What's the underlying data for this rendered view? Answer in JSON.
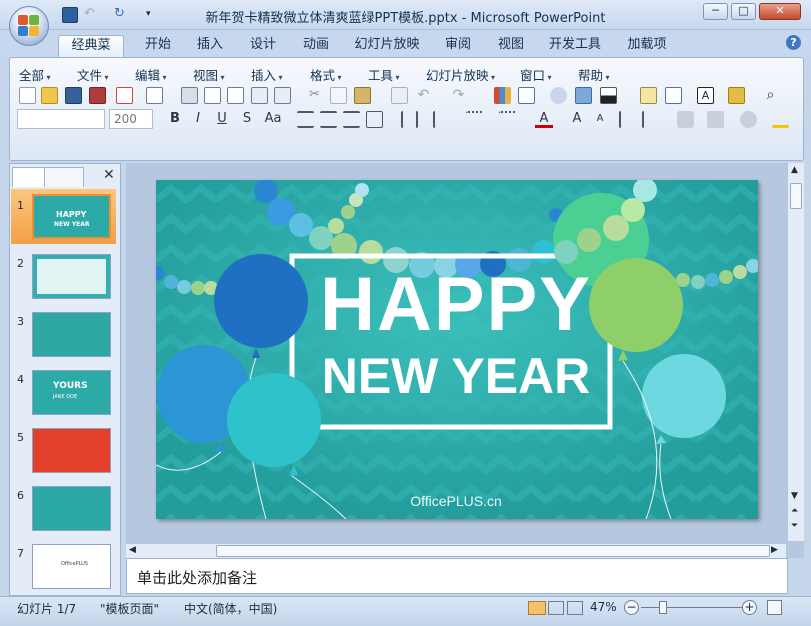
{
  "window": {
    "title": "新年贺卡精致微立体清爽蓝绿PPT模板.pptx - Microsoft PowerPoint",
    "minimize": "─",
    "maximize": "□",
    "close": "✕"
  },
  "tabs": [
    "经典菜单",
    "开始",
    "插入",
    "设计",
    "动画",
    "幻灯片放映",
    "审阅",
    "视图",
    "开发工具",
    "加载项"
  ],
  "help_glyph": "?",
  "menu": [
    "全部",
    "文件",
    "编辑",
    "视图",
    "插入",
    "格式",
    "工具",
    "幻灯片放映",
    "窗口",
    "帮助"
  ],
  "font_size_value": "200",
  "format_buttons": [
    "B",
    "I",
    "U",
    "S",
    "Aa"
  ],
  "slide_numbers": [
    "1",
    "2",
    "3",
    "4",
    "5",
    "6",
    "7"
  ],
  "thumb_texts": {
    "t1a": "HAPPY",
    "t1b": "NEW YEAR",
    "t4a": "YOURS",
    "t4b": "JANE DOE",
    "t7": "OfficePLUS"
  },
  "slide": {
    "line1": "HAPPY",
    "line2": "NEW YEAR",
    "brand": "OfficePLUS.cn"
  },
  "notes_placeholder": "单击此处添加备注",
  "status": {
    "slide_count": "幻灯片 1/7",
    "template": "\"模板页面\"",
    "language": "中文(简体，中国)",
    "zoom": "47%",
    "minus": "−",
    "plus": "+"
  },
  "colors": {
    "slide_bg": "#29aaa8",
    "accent_blue": "#1f6fc3",
    "accent_green": "#8fcf6a"
  }
}
